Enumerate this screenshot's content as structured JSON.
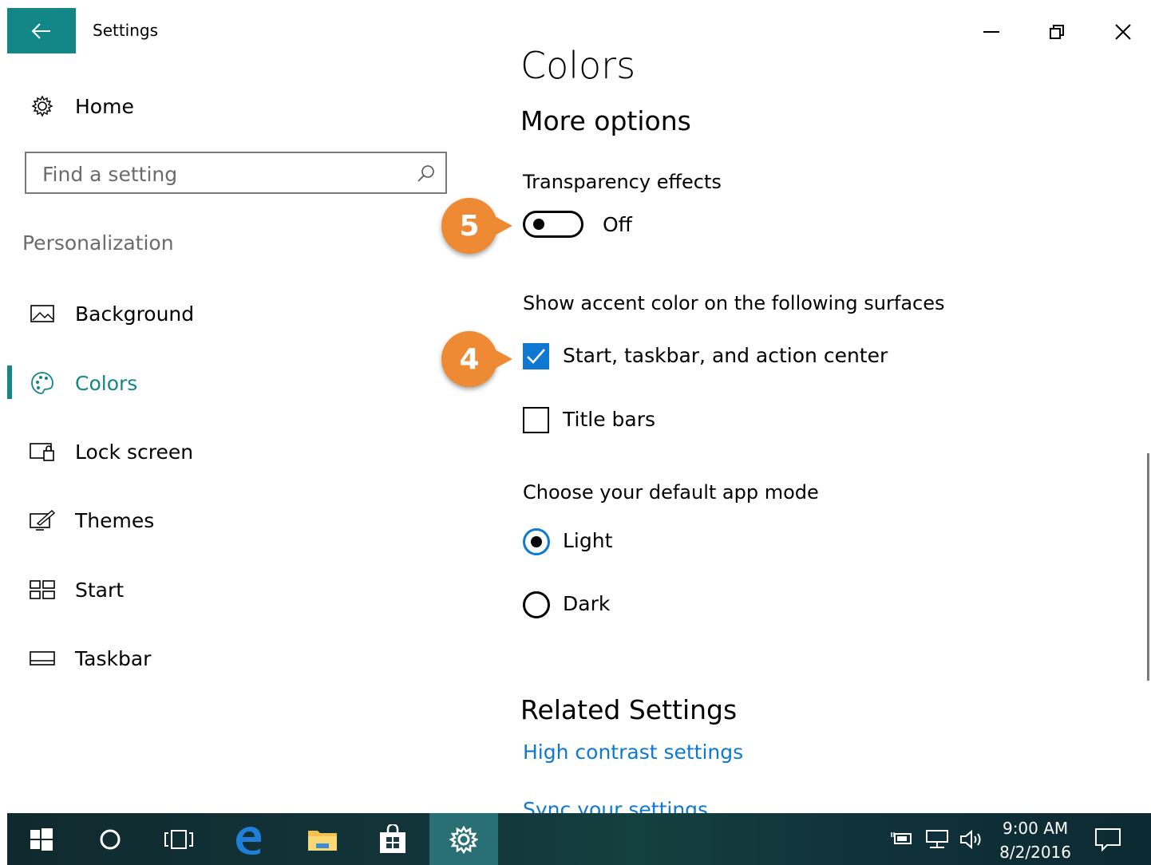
{
  "window": {
    "title": "Settings",
    "accent": "#138688"
  },
  "sidebar": {
    "home_label": "Home",
    "search_placeholder": "Find a setting",
    "section_label": "Personalization",
    "items": [
      {
        "label": "Background",
        "icon": "picture-icon",
        "active": false
      },
      {
        "label": "Colors",
        "icon": "palette-icon",
        "active": true
      },
      {
        "label": "Lock screen",
        "icon": "lock-screen-icon",
        "active": false
      },
      {
        "label": "Themes",
        "icon": "themes-icon",
        "active": false
      },
      {
        "label": "Start",
        "icon": "start-tiles-icon",
        "active": false
      },
      {
        "label": "Taskbar",
        "icon": "taskbar-icon",
        "active": false
      }
    ]
  },
  "main": {
    "title": "Colors",
    "subtitle": "More options",
    "transparency": {
      "label": "Transparency effects",
      "state_label": "Off"
    },
    "accent_surfaces": {
      "label": "Show accent color on the following surfaces",
      "options": [
        {
          "label": "Start, taskbar, and action center",
          "checked": true
        },
        {
          "label": "Title bars",
          "checked": false
        }
      ]
    },
    "app_mode": {
      "label": "Choose your default app mode",
      "options": [
        {
          "label": "Light",
          "selected": true
        },
        {
          "label": "Dark",
          "selected": false
        }
      ]
    },
    "related": {
      "title": "Related Settings",
      "links": [
        "High contrast settings",
        "Sync your settings"
      ]
    }
  },
  "callouts": [
    "5",
    "4"
  ],
  "taskbar": {
    "time": "9:00 AM",
    "date": "8/2/2016",
    "link_color": "#0e78d3"
  }
}
